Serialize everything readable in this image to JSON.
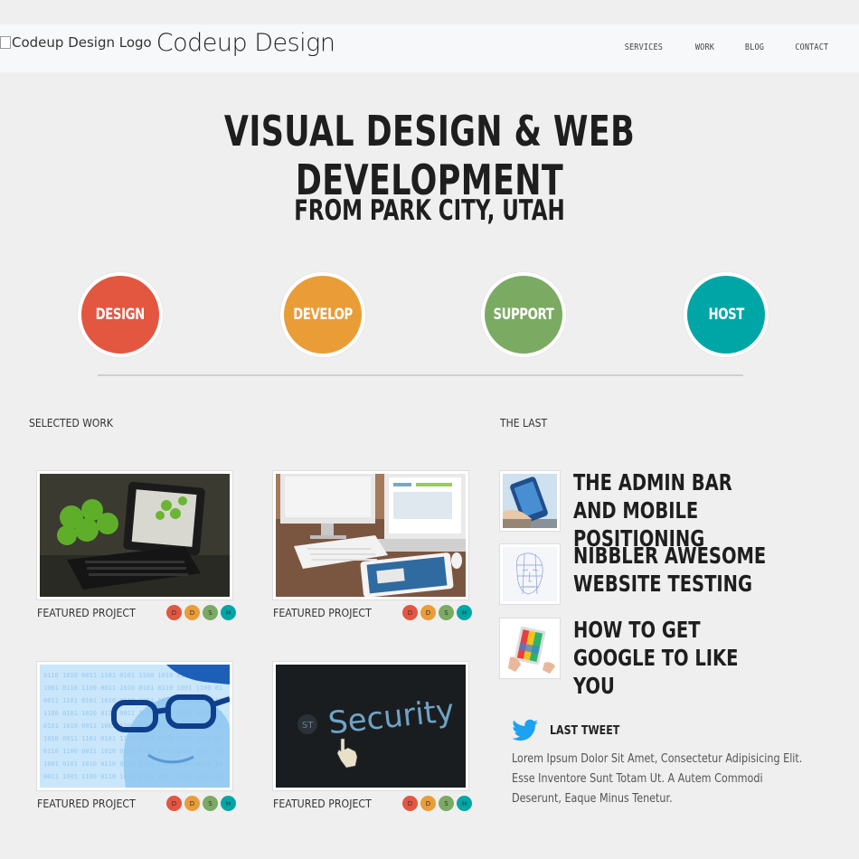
{
  "header": {
    "logo_alt": "Codeup Design Logo",
    "brand": "Codeup Design",
    "nav": [
      "SERVICES",
      "WORK",
      "BLOG",
      "CONTACT"
    ]
  },
  "hero": {
    "title": "VISUAL DESIGN & WEB DEVELOPMENT",
    "subtitle": "FROM PARK CITY, UTAH"
  },
  "services": [
    {
      "label": "DESIGN",
      "color": "#e35640"
    },
    {
      "label": "DEVELOP",
      "color": "#ea9c37"
    },
    {
      "label": "SUPPORT",
      "color": "#7baa63"
    },
    {
      "label": "HOST",
      "color": "#00a6a6"
    }
  ],
  "work": {
    "heading": "SELECTED WORK",
    "projects": [
      {
        "label": "FEATURED PROJECT",
        "image": "tablet-keyboard-apples",
        "tags": [
          "D",
          "D",
          "S",
          "H"
        ]
      },
      {
        "label": "FEATURED PROJECT",
        "image": "desk-computers",
        "tags": [
          "D",
          "D",
          "S",
          "H"
        ]
      },
      {
        "label": "FEATURED PROJECT",
        "image": "man-glasses-binary",
        "tags": [
          "D",
          "D",
          "S",
          "H"
        ]
      },
      {
        "label": "FEATURED PROJECT",
        "image": "security-screen",
        "tags": [
          "D",
          "D",
          "S",
          "H"
        ]
      }
    ]
  },
  "blog": {
    "heading": "THE LAST",
    "posts": [
      {
        "title": "THE ADMIN BAR AND MOBILE POSITIONING",
        "image": "phone-in-hand"
      },
      {
        "title": "NIBBLER AWESOME WEBSITE TESTING",
        "image": "wireframe-face"
      },
      {
        "title": "HOW TO GET GOOGLE TO LIKE YOU",
        "image": "hands-tablet"
      }
    ]
  },
  "tweet": {
    "heading": "LAST TWEET",
    "icon": "twitter-bird-icon",
    "text": "Lorem Ipsum Dolor Sit Amet, Consectetur Adipisicing Elit. Esse Inventore Sunt Totam Ut. A Autem Commodi Deserunt, Eaque Minus Tenetur."
  }
}
